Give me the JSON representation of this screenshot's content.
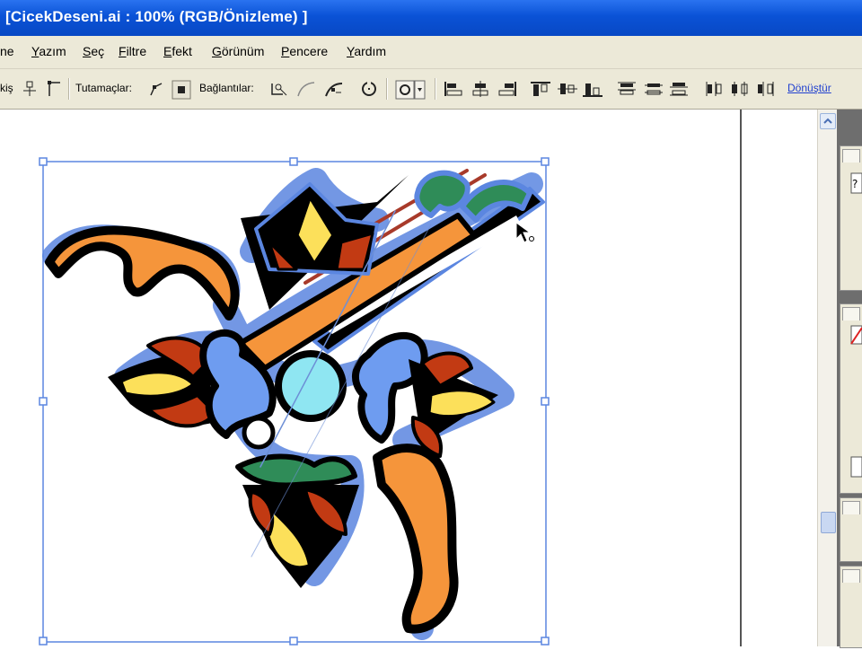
{
  "window": {
    "title": "[CicekDeseni.ai : 100% (RGB/Önizleme) ]"
  },
  "menu": {
    "items": [
      {
        "label": "ne",
        "accel": ""
      },
      {
        "label": "azım",
        "accel": "Y"
      },
      {
        "label": "eç",
        "accel": "S"
      },
      {
        "label": "iltre",
        "accel": "F"
      },
      {
        "label": "fekt",
        "accel": "E"
      },
      {
        "label": "örünüm",
        "accel": "G"
      },
      {
        "label": "encere",
        "accel": "P"
      },
      {
        "label": "ardım",
        "accel": "Y"
      }
    ]
  },
  "toolbar": {
    "left_label": "kiş",
    "handles_label": "Tutamaçlar:",
    "anchors_label": "Bağlantılar:",
    "convert_link": "Dönüştür"
  },
  "artwork": {
    "colors": {
      "outline": "#000000",
      "selection": "#5b86e0",
      "orange": "#f5953b",
      "yellow": "#fce05a",
      "red": "#c23a13",
      "blue": "#6e9cf0",
      "cyan": "#8fe6f2",
      "green": "#2f8c58"
    }
  }
}
